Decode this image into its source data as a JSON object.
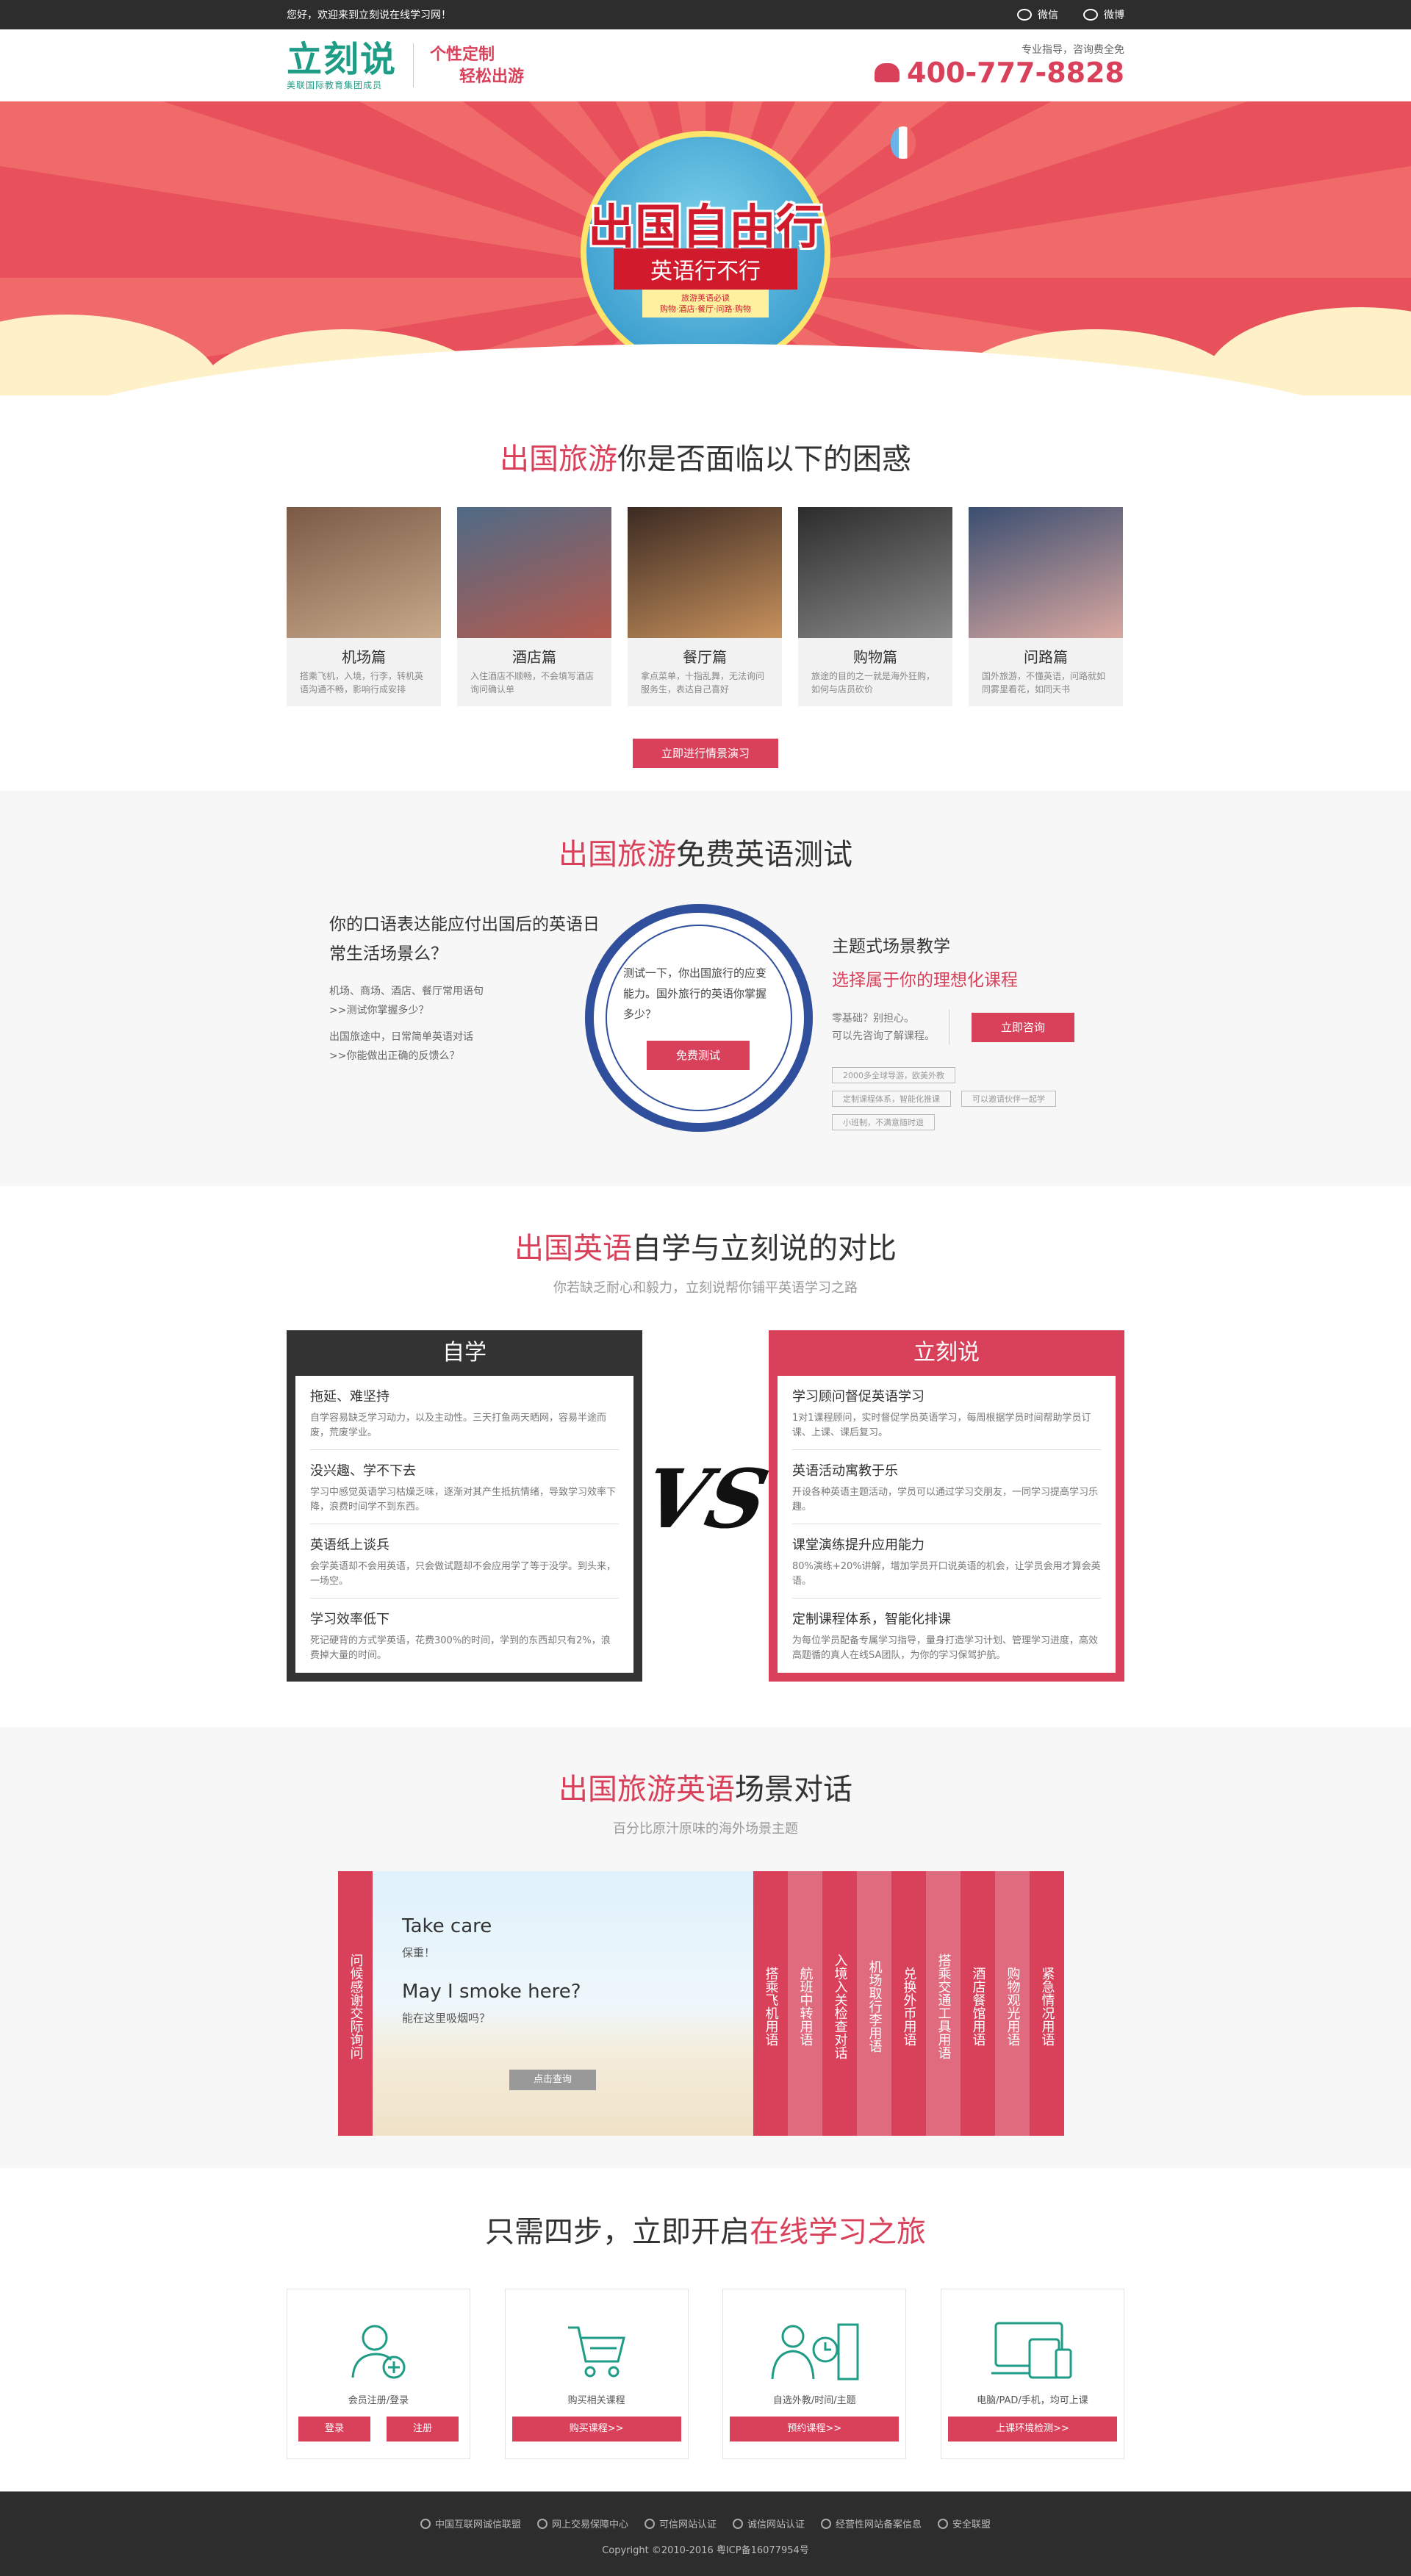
{
  "topbar": {
    "welcome": "您好，欢迎来到立刻说在线学习网！",
    "wechat": "微信",
    "weibo": "微博"
  },
  "header": {
    "logo": "立刻说",
    "logo_sub": "美联国际教育集团成员",
    "slogan_1": "个性定制",
    "slogan_2": "轻松出游",
    "hotline_note": "专业指导，咨询费全免",
    "hotline": "400-777-8828"
  },
  "banner": {
    "title": "出国自由行",
    "subtitle": "英语行不行",
    "small_1": "旅游英语必读",
    "small_2": "购物·酒店·餐厅·问路·购物"
  },
  "problems": {
    "title_hl": "出国旅游",
    "title_rest": "你是否面临以下的困惑",
    "cards": [
      {
        "title": "机场篇",
        "desc": "搭乘飞机，入境，行李，转机英语沟通不畅，影响行成安排",
        "colors": [
          "#7a5a45",
          "#c9a98b"
        ]
      },
      {
        "title": "酒店篇",
        "desc": "入住酒店不顺畅，不会填写酒店询问确认单",
        "colors": [
          "#4f6b86",
          "#b55a4d"
        ]
      },
      {
        "title": "餐厅篇",
        "desc": "拿点菜单，十指乱舞，无法询问服务生，表达自己喜好",
        "colors": [
          "#3b2a22",
          "#c8925d"
        ]
      },
      {
        "title": "购物篇",
        "desc": "旅途的目的之一就是海外狂购，如何与店员砍价",
        "colors": [
          "#2c2c2c",
          "#8a8a8a"
        ]
      },
      {
        "title": "问路篇",
        "desc": "国外旅游，不懂英语，问路就如同雾里看花，如同天书",
        "colors": [
          "#3a4e70",
          "#d9a8a0"
        ]
      }
    ],
    "cta": "立即进行情景演习"
  },
  "test": {
    "title_hl": "出国旅游",
    "title_rest": "免费英语测试",
    "left_q": "你的口语表达能应付出国后的英语日常生活场景么？",
    "left_s1a": "机场、商场、酒店、餐厅常用语句",
    "left_s1b": ">>测试你掌握多少？",
    "left_s2a": "出国旅途中，日常简单英语对话",
    "left_s2b": ">>你能做出正确的反馈么？",
    "ring_text": "测试一下，你出国旅行的应变能力。国外旅行的英语你掌握多少？",
    "ring_btn": "免费测试",
    "right_h1": "主题式场景教学",
    "right_h2": "选择属于你的理想化课程",
    "right_l1": "零基础？别担心。",
    "right_l2": "可以先咨询了解课程。",
    "right_btn": "立即咨询",
    "tags": [
      "2000多全球导游，欧美外教",
      "定制课程体系，智能化推课",
      "可以邀请伙伴一起学",
      "小班制，不满意随时退"
    ]
  },
  "compare": {
    "title_hl": "出国英语",
    "title_rest": "自学与立刻说的对比",
    "subtitle": "你若缺乏耐心和毅力，立刻说帮你铺平英语学习之路",
    "vs": "VS",
    "left": {
      "head": "自学",
      "items": [
        {
          "t": "拖延、难坚持",
          "d": "自学容易缺乏学习动力，以及主动性。三天打鱼两天晒网，容易半途而废，荒废学业。"
        },
        {
          "t": "没兴趣、学不下去",
          "d": "学习中感觉英语学习枯燥乏味，逐渐对其产生抵抗情绪，导致学习效率下降，浪费时间学不到东西。"
        },
        {
          "t": "英语纸上谈兵",
          "d": "会学英语却不会用英语，只会做试题却不会应用学了等于没学。到头来，一场空。"
        },
        {
          "t": "学习效率低下",
          "d": "死记硬背的方式学英语，花费300%的时间，学到的东西却只有2%，浪费掉大量的时间。"
        }
      ]
    },
    "right": {
      "head": "立刻说",
      "items": [
        {
          "t": "学习顾问督促英语学习",
          "d": "1对1课程顾问，实时督促学员英语学习，每周根据学员时间帮助学员订课、上课、课后复习。"
        },
        {
          "t": "英语活动寓教于乐",
          "d": "开设各种英语主题活动，学员可以通过学习交朋友，一同学习提高学习乐趣。"
        },
        {
          "t": "课堂演练提升应用能力",
          "d": "80%演练+20%讲解，增加学员开口说英语的机会，让学员会用才算会英语。"
        },
        {
          "t": "定制课程体系，智能化排课",
          "d": "为每位学员配备专属学习指导，量身打造学习计划、管理学习进度，高效高题循的真人在线SA团队，为你的学习保驾护航。"
        }
      ]
    }
  },
  "scene": {
    "title_hl": "出国旅游英语",
    "title_rest": "场景对话",
    "subtitle": "百分比原汁原味的海外场景主题",
    "left_tab": "问候感谢交际询问",
    "phrase1_en": "Take care",
    "phrase1_cn": "保重！",
    "phrase2_en": "May I smoke here?",
    "phrase2_cn": "能在这里吸烟吗？",
    "btn": "点击查询",
    "tabs": [
      "搭乘飞机用语",
      "航班中转用语",
      "入境入关检查对话",
      "机场取行李用语",
      "兑换外币用语",
      "搭乘交通工具用语",
      "酒店餐馆用语",
      "购物观光用语",
      "紧急情况用语"
    ]
  },
  "steps": {
    "title_a": "只需四步，立即开启",
    "title_hl": "在线学习之旅",
    "items": [
      {
        "label": "会员注册/登录",
        "icon": "user-plus-icon"
      },
      {
        "label": "购买相关课程",
        "icon": "cart-icon"
      },
      {
        "label": "自选外教/时间/主题",
        "icon": "teacher-clock-icon"
      },
      {
        "label": "电脑/PAD/手机，均可上课",
        "icon": "devices-icon"
      }
    ],
    "btn_login": "登录",
    "btn_register": "注册",
    "btn_buy": "购买课程>>",
    "btn_book": "预约课程>>",
    "btn_check": "上课环境检测>>"
  },
  "footer": {
    "links": [
      "中国互联网诚信联盟",
      "网上交易保障中心",
      "可信网站认证",
      "诚信网站认证",
      "经营性网站备案信息",
      "安全联盟"
    ],
    "copyright": "Copyright ©2010-2016 粤ICP备16077954号"
  },
  "colors": {
    "accent": "#d9415b",
    "brand_green": "#1f9c86",
    "dark": "#2d2d2d",
    "ring_blue": "#2f4f9c"
  }
}
